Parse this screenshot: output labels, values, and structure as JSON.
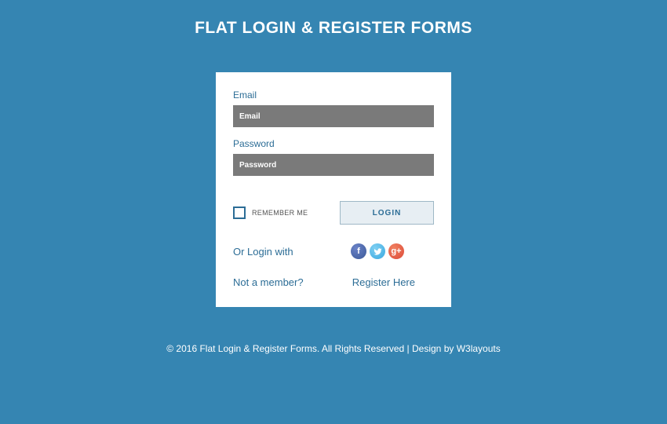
{
  "title": "FLAT LOGIN & REGISTER FORMS",
  "form": {
    "email": {
      "label": "Email",
      "placeholder": "Email",
      "value": ""
    },
    "password": {
      "label": "Password",
      "placeholder": "Password",
      "value": ""
    },
    "remember_label": "REMEMBER ME",
    "login_button": "LOGIN",
    "or_login_with": "Or Login with",
    "social": {
      "facebook": "f",
      "twitter": "twitter-icon",
      "google": "g+"
    },
    "not_member": "Not a member?",
    "register_link": "Register Here"
  },
  "footer": {
    "text": "© 2016 Flat Login & Register Forms. All Rights Reserved | Design by ",
    "link_text": "W3layouts"
  },
  "colors": {
    "background": "#3585b2",
    "card": "#ffffff",
    "accent": "#2c6d96",
    "input_bg": "#7a7a7a"
  }
}
